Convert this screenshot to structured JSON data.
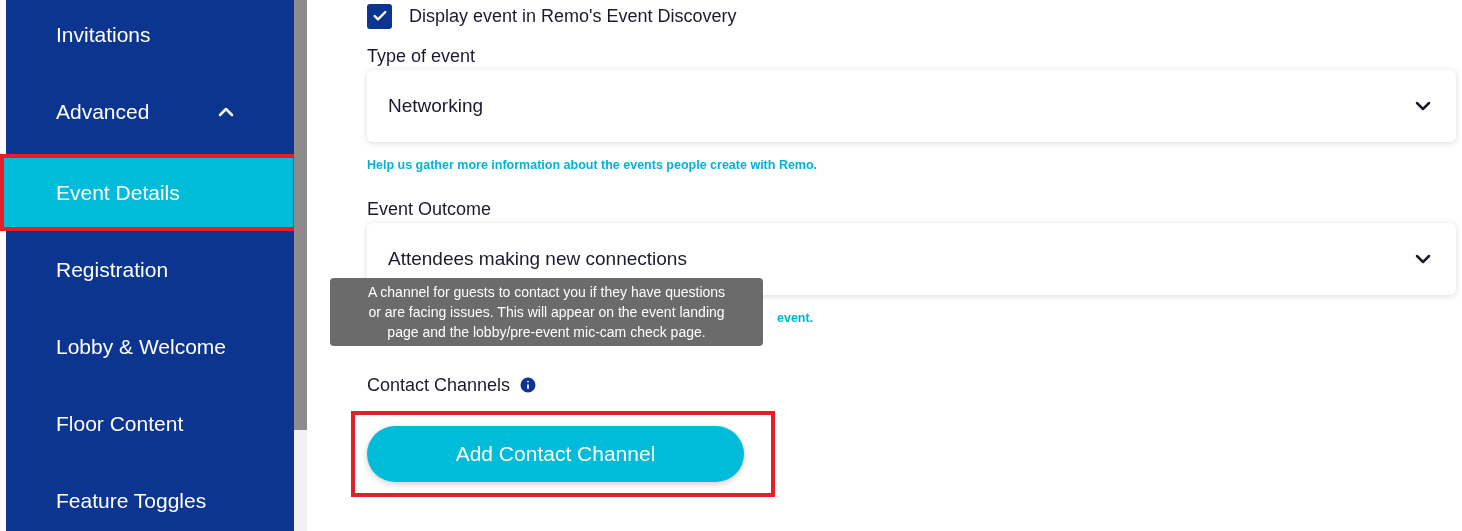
{
  "sidebar": {
    "items": [
      {
        "label": "Invitations",
        "selected": false,
        "highlighted": false
      },
      {
        "label": "Advanced",
        "selected": false,
        "highlighted": false,
        "expanded": true
      },
      {
        "label": "Event Details",
        "selected": true,
        "highlighted": true
      },
      {
        "label": "Registration",
        "selected": false,
        "highlighted": false
      },
      {
        "label": "Lobby & Welcome",
        "selected": false,
        "highlighted": false
      },
      {
        "label": "Floor Content",
        "selected": false,
        "highlighted": false
      },
      {
        "label": "Feature Toggles",
        "selected": false,
        "highlighted": false
      }
    ]
  },
  "discovery": {
    "label": "Display event in Remo's Event Discovery",
    "checked": true
  },
  "type_of_event": {
    "label": "Type of event",
    "value": "Networking",
    "help": "Help us gather more information about the events people create with Remo."
  },
  "event_outcome": {
    "label": "Event Outcome",
    "value": "Attendees making new connections",
    "help": "event."
  },
  "tooltip": "A channel for guests to contact you if they have questions or are facing issues. This will appear on the event landing page and the lobby/pre-event mic-cam check page.",
  "contact_channels": {
    "label": "Contact Channels",
    "button": "Add Contact Channel",
    "highlighted": true
  }
}
